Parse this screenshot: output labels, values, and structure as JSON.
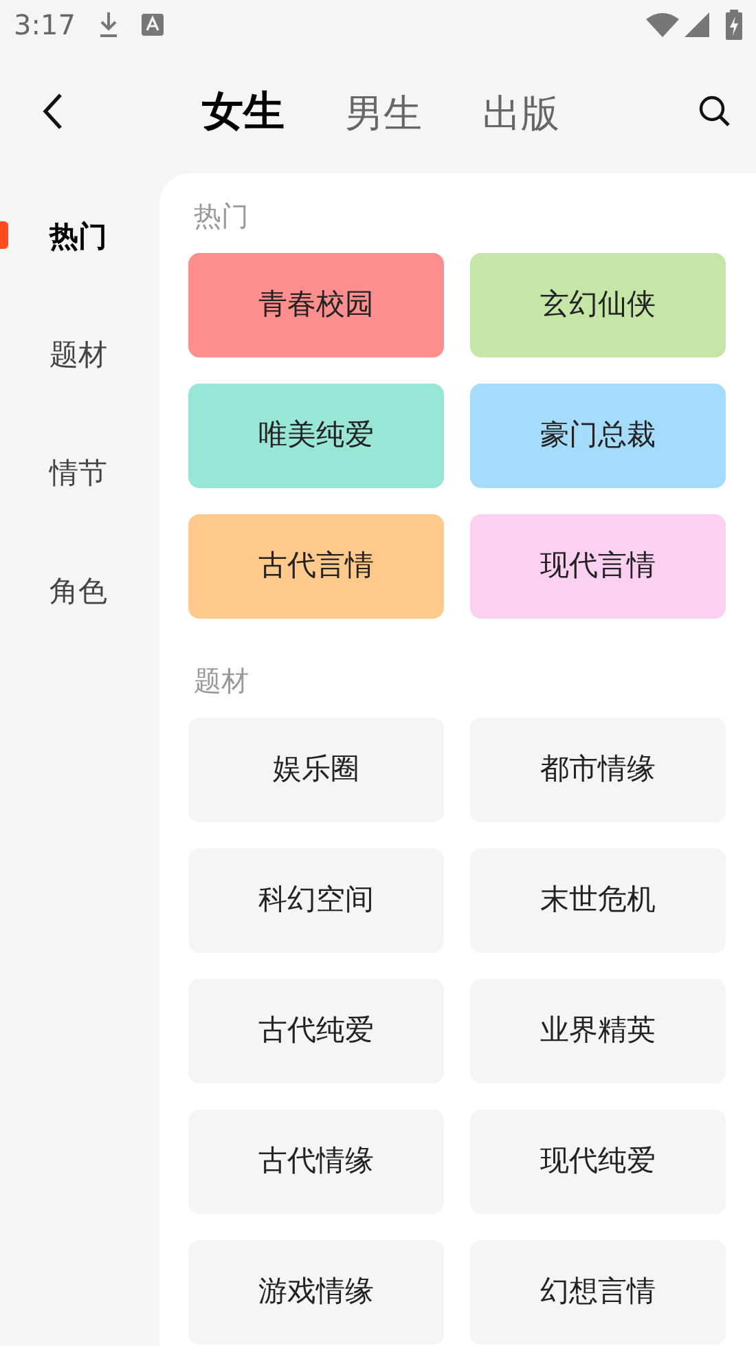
{
  "status_bar": {
    "time": "3:17"
  },
  "header": {
    "tabs": [
      {
        "label": "女生",
        "selected": true
      },
      {
        "label": "男生",
        "selected": false
      },
      {
        "label": "出版",
        "selected": false
      }
    ]
  },
  "sidebar": {
    "items": [
      {
        "label": "热门",
        "selected": true
      },
      {
        "label": "题材",
        "selected": false
      },
      {
        "label": "情节",
        "selected": false
      },
      {
        "label": "角色",
        "selected": false
      }
    ]
  },
  "sections": [
    {
      "title": "热门",
      "tiles": [
        {
          "label": "青春校园",
          "color": "#ff8f8f"
        },
        {
          "label": "玄幻仙侠",
          "color": "#c5e6a6"
        },
        {
          "label": "唯美纯爱",
          "color": "#98e6d8"
        },
        {
          "label": "豪门总裁",
          "color": "#a5dbfb"
        },
        {
          "label": "古代言情",
          "color": "#ffca8c"
        },
        {
          "label": "现代言情",
          "color": "#fbd0f0"
        }
      ]
    },
    {
      "title": "题材",
      "tiles": [
        {
          "label": "娱乐圈"
        },
        {
          "label": "都市情缘"
        },
        {
          "label": "科幻空间"
        },
        {
          "label": "末世危机"
        },
        {
          "label": "古代纯爱"
        },
        {
          "label": "业界精英"
        },
        {
          "label": "古代情缘"
        },
        {
          "label": "现代纯爱"
        },
        {
          "label": "游戏情缘"
        },
        {
          "label": "幻想言情"
        }
      ]
    }
  ]
}
